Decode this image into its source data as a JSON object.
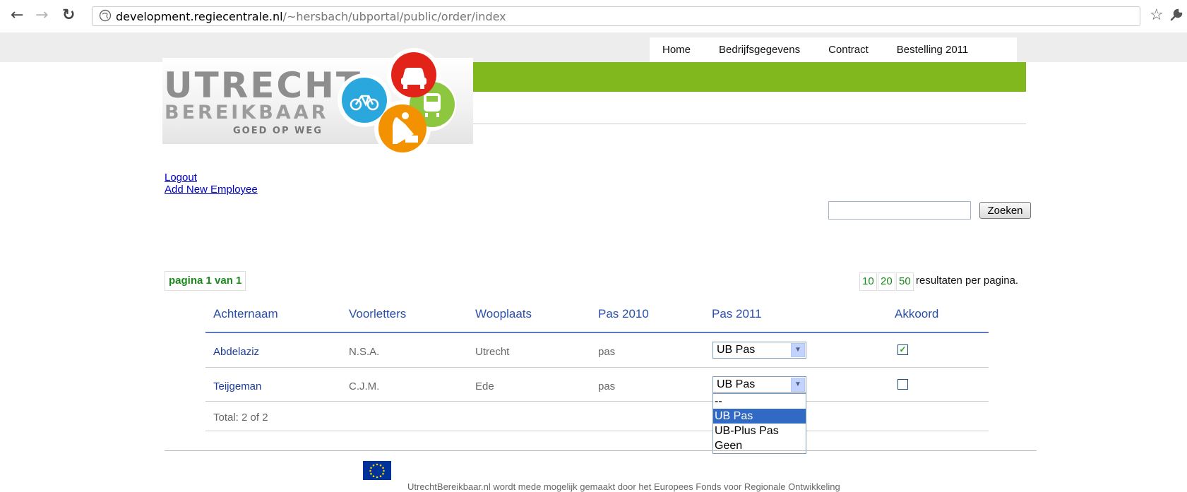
{
  "browser": {
    "url_host": "development.regiecentrale.nl",
    "url_path": "/~hersbach/ubportal/public/order/index"
  },
  "nav": {
    "items": [
      "Home",
      "Bedrijfsgegevens",
      "Contract",
      "Bestelling 2011"
    ]
  },
  "logo": {
    "line1": "UTRECHT",
    "line2": "BEREIKBAAR",
    "line3": "GOED OP WEG"
  },
  "links": {
    "logout": "Logout",
    "add_employee": "Add New Employee"
  },
  "search": {
    "value": "",
    "button": "Zoeken"
  },
  "pager": {
    "label": "pagina 1 van 1",
    "per_page_options": [
      "10",
      "20",
      "50"
    ],
    "per_page_label": "resultaten per pagina."
  },
  "table": {
    "headers": [
      "Achternaam",
      "Voorletters",
      "Wooplaats",
      "Pas 2010",
      "Pas 2011",
      "Akkoord"
    ],
    "rows": [
      {
        "achternaam": "Abdelaziz",
        "voorletters": "N.S.A.",
        "woonplaats": "Utrecht",
        "pas2010": "pas",
        "pas2011": "UB Pas",
        "akkoord": true
      },
      {
        "achternaam": "Teijgeman",
        "voorletters": "C.J.M.",
        "woonplaats": "Ede",
        "pas2010": "pas",
        "pas2011": "UB Pas",
        "akkoord": false
      }
    ],
    "total": "Total: 2 of 2"
  },
  "dropdown": {
    "options": [
      "--",
      "UB Pas",
      "UB-Plus Pas",
      "Geen"
    ],
    "selected_index": 1
  },
  "footer": {
    "text": "UtrechtBereikbaar.nl wordt mede mogelijk gemaakt door het Europees Fonds voor Regionale Ontwikkeling"
  },
  "colors": {
    "accent_green": "#80b81e",
    "link_blue": "#1c3c9c",
    "pager_green": "#1b8a1b"
  },
  "icons": [
    "back-arrow-icon",
    "forward-arrow-icon",
    "reload-icon",
    "globe-icon",
    "star-icon",
    "wrench-icon",
    "car-icon",
    "bicycle-icon",
    "train-icon",
    "roadworker-icon",
    "eu-flag-icon"
  ]
}
